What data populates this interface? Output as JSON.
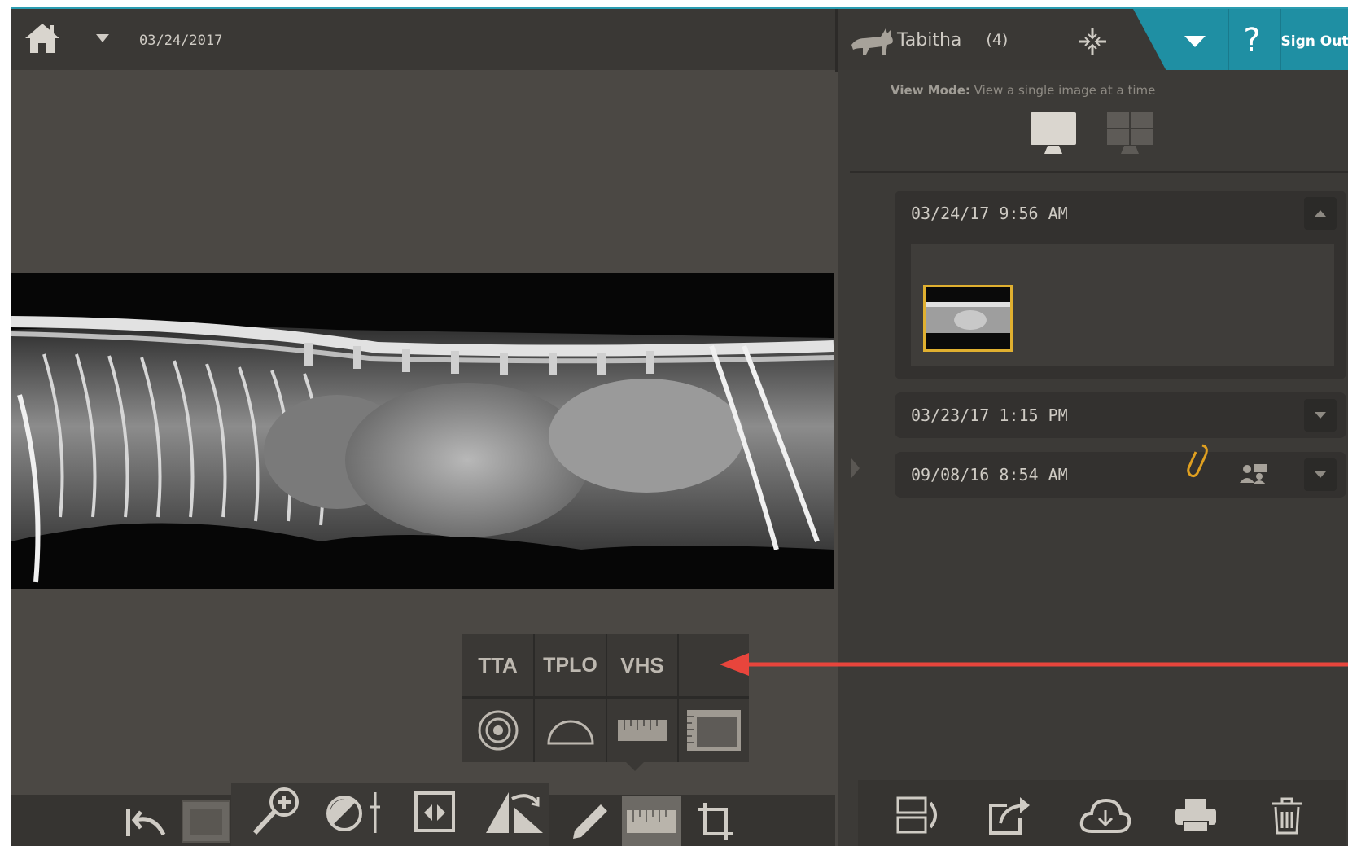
{
  "header": {
    "date": "03/24/2017",
    "patient_name": "Tabitha",
    "patient_count": "(4)",
    "help_label": "?",
    "sign_out_label": "Sign Out"
  },
  "view_mode": {
    "label": "View Mode:",
    "description": "View a single image at a time"
  },
  "studies": [
    {
      "datetime": "03/24/17 9:56 AM",
      "expanded": true
    },
    {
      "datetime": "03/23/17 1:15 PM",
      "expanded": false
    },
    {
      "datetime": "09/08/16 8:54 AM",
      "expanded": false,
      "has_attachment": true,
      "shared": true
    }
  ],
  "measure_popup": {
    "tabs": [
      "TTA",
      "TPLO",
      "VHS"
    ],
    "icons": [
      "circle-target-icon",
      "semicircle-icon",
      "ruler-icon",
      "calibration-ruler-icon"
    ]
  },
  "colors": {
    "accent": "#1f8fa3",
    "selection": "#e0b030",
    "annotation_arrow": "#e8453c",
    "background": "#4b4844"
  }
}
